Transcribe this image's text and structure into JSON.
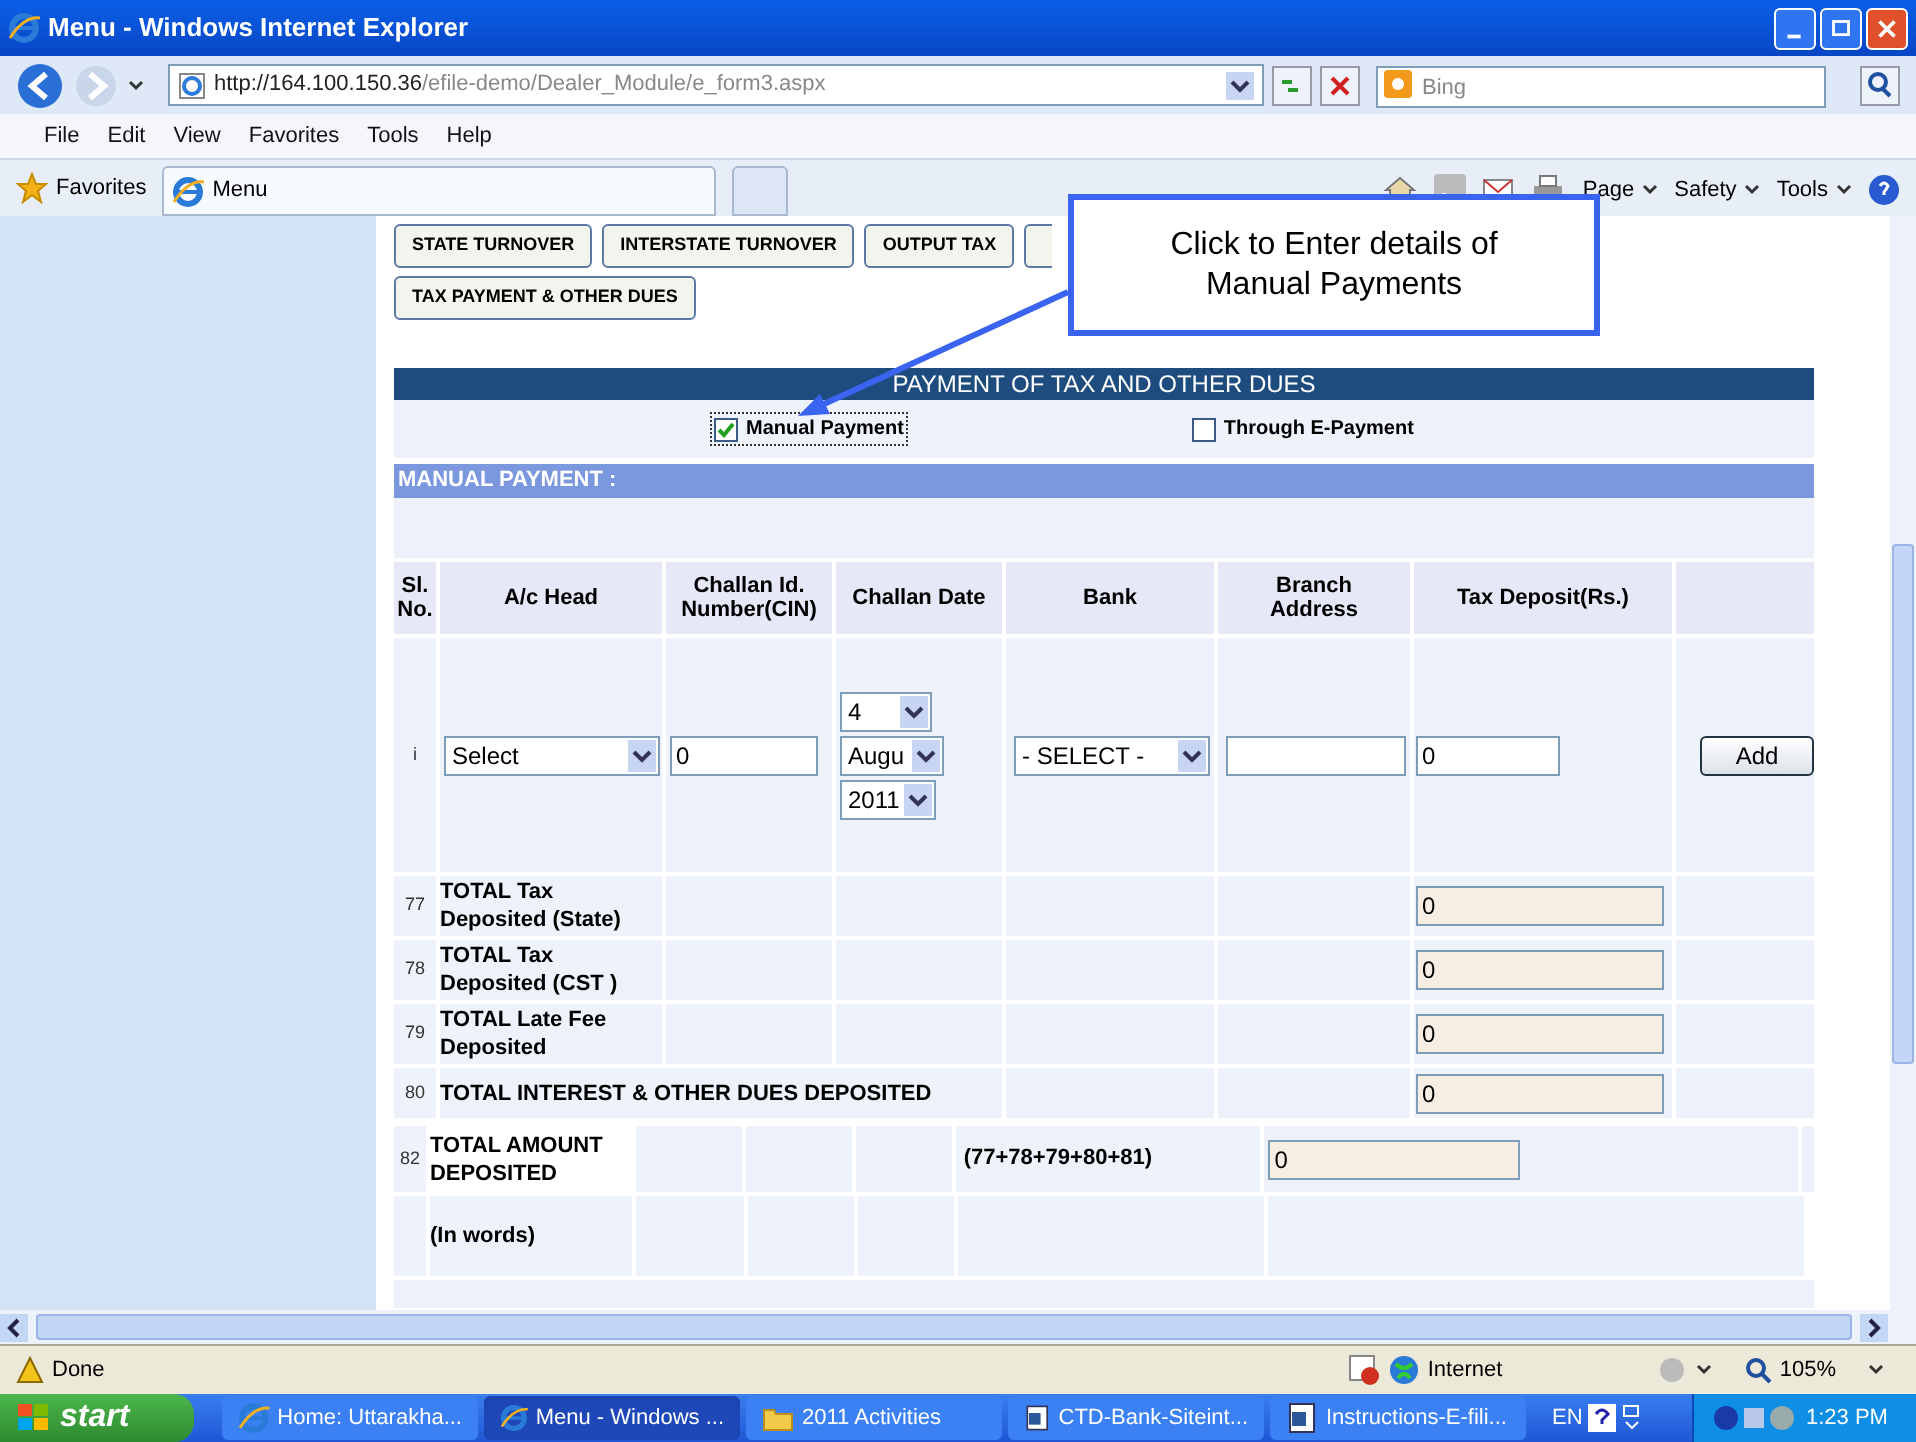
{
  "window": {
    "title": "Menu - Windows Internet Explorer"
  },
  "address_bar": {
    "url_host": "http://164.100.150.36",
    "url_path": "/efile-demo/Dealer_Module/e_form3.aspx"
  },
  "search": {
    "placeholder": "Bing"
  },
  "menu": [
    "File",
    "Edit",
    "View",
    "Favorites",
    "Tools",
    "Help"
  ],
  "favorites": {
    "label": "Favorites"
  },
  "tabs": [
    {
      "label": "Menu",
      "selected": true
    }
  ],
  "command_bar": [
    "Page",
    "Safety",
    "Tools"
  ],
  "section_buttons": [
    {
      "label": "STATE TURNOVER"
    },
    {
      "label": "INTERSTATE TURNOVER"
    },
    {
      "label": "OUTPUT TAX"
    },
    {
      "label": "TAX PAYMENT & OTHER DUES"
    }
  ],
  "callout": {
    "text": "Click to Enter details of Manual Payments"
  },
  "section_title": "PAYMENT OF TAX AND OTHER DUES",
  "payment_options": [
    {
      "label": "Manual Payment",
      "checked": true
    },
    {
      "label": "Through E-Payment",
      "checked": false
    }
  ],
  "manual_heading": "MANUAL PAYMENT :",
  "table": {
    "columns": [
      "Sl.\nNo.",
      "A/c Head",
      "Challan Id.\nNumber(CIN)",
      "Challan Date",
      "Bank",
      "Branch\nAddress",
      "Tax Deposit(Rs.)"
    ],
    "row": {
      "sl": "i",
      "ac_head": "Select",
      "cin": "0",
      "day": "4",
      "month": "Augu",
      "year": "2011",
      "bank": "- SELECT -",
      "tax": "0",
      "add": "Add"
    }
  },
  "totals": [
    {
      "num": "77",
      "label": "TOTAL Tax\nDeposited  (State)",
      "value": "0"
    },
    {
      "num": "78",
      "label": "TOTAL Tax\nDeposited  (CST )",
      "value": "0"
    },
    {
      "num": "79",
      "label": "TOTAL Late Fee\nDeposited",
      "value": "0"
    },
    {
      "num": "80",
      "label": "TOTAL INTEREST & OTHER DUES DEPOSITED",
      "value": "0"
    }
  ],
  "total_amount": {
    "num": "82",
    "label": "TOTAL AMOUNT\nDEPOSITED",
    "formula": "(77+78+79+80+81)",
    "value": "0"
  },
  "in_words": {
    "label": "(In words)"
  },
  "status_bar": {
    "text": "Done",
    "zone": "Internet",
    "zoom": "105%"
  },
  "taskbar": {
    "start": "start",
    "items": [
      {
        "label": "Home: Uttarakha...",
        "kind": "browser",
        "selected": false
      },
      {
        "label": "Menu - Windows ...",
        "kind": "browser",
        "selected": true
      },
      {
        "label": "2011 Activities",
        "kind": "folder",
        "selected": false
      },
      {
        "label": "CTD-Bank-Siteint...",
        "kind": "document",
        "selected": false
      },
      {
        "label": "Instructions-E-fili...",
        "kind": "document",
        "selected": false
      }
    ],
    "language": "EN",
    "clock": "1:23 PM"
  }
}
